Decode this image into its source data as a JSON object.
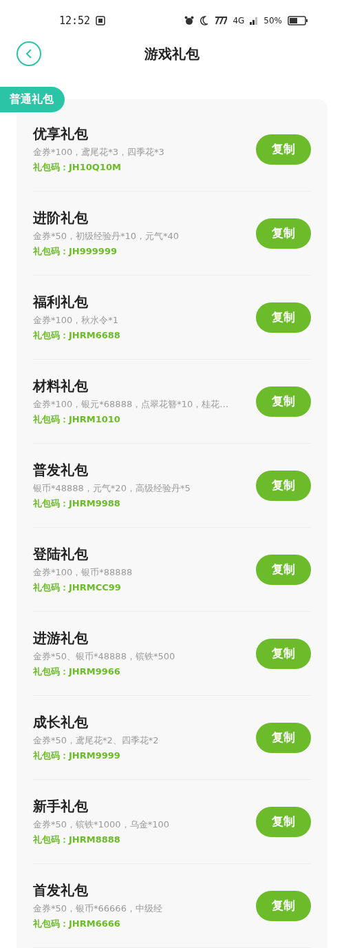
{
  "status_bar": {
    "time": "12:52",
    "network": "4G",
    "battery": "50%"
  },
  "header": {
    "title": "游戏礼包"
  },
  "section": {
    "label": "普通礼包"
  },
  "gifts": [
    {
      "name": "优享礼包",
      "contents": "金券*100，鸢尾花*3，四季花*3",
      "code": "礼包码：JH10Q10M",
      "button": "复制"
    },
    {
      "name": "进阶礼包",
      "contents": "金券*50，初级经验丹*10，元气*40",
      "code": "礼包码：JH999999",
      "button": "复制"
    },
    {
      "name": "福利礼包",
      "contents": "金券*100，秋水令*1",
      "code": "礼包码：JHRM6688",
      "button": "复制"
    },
    {
      "name": "材料礼包",
      "contents": "金券*100，银元*68888，点翠花簪*10，桂花…",
      "code": "礼包码：JHRM1010",
      "button": "复制"
    },
    {
      "name": "普发礼包",
      "contents": "银币*48888，元气*20，高级经验丹*5",
      "code": "礼包码：JHRM9988",
      "button": "复制"
    },
    {
      "name": "登陆礼包",
      "contents": "金券*100，银币*88888",
      "code": "礼包码：JHRMCC99",
      "button": "复制"
    },
    {
      "name": "进游礼包",
      "contents": "金券*50、银币*48888，镔铁*500",
      "code": "礼包码：JHRM9966",
      "button": "复制"
    },
    {
      "name": "成长礼包",
      "contents": "金券*50，鸢尾花*2、四季花*2",
      "code": "礼包码：JHRM9999",
      "button": "复制"
    },
    {
      "name": "新手礼包",
      "contents": "金券*50，镔铁*1000，乌金*100",
      "code": "礼包码：JHRM8888",
      "button": "复制"
    },
    {
      "name": "首发礼包",
      "contents": "金券*50，银币*66666，中级经",
      "code": "礼包码：JHRM6666",
      "button": "复制"
    }
  ]
}
